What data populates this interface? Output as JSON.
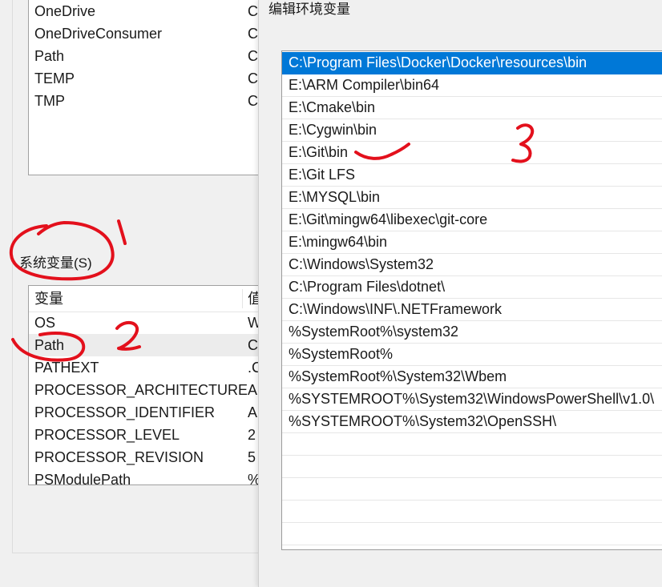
{
  "env_window": {
    "user_vars": [
      {
        "name": "OneDrive",
        "value": "C"
      },
      {
        "name": "OneDriveConsumer",
        "value": "C"
      },
      {
        "name": "Path",
        "value": "C"
      },
      {
        "name": "TEMP",
        "value": "C"
      },
      {
        "name": "TMP",
        "value": "C"
      }
    ],
    "system_section_label": "系统变量(S)",
    "system_table": {
      "header_variable": "变量",
      "header_value": "值",
      "rows": [
        {
          "name": "OS",
          "value": "W"
        },
        {
          "name": "Path",
          "value": "C"
        },
        {
          "name": "PATHEXT",
          "value": ".C"
        },
        {
          "name": "PROCESSOR_ARCHITECTURE",
          "value": "A"
        },
        {
          "name": "PROCESSOR_IDENTIFIER",
          "value": "A"
        },
        {
          "name": "PROCESSOR_LEVEL",
          "value": "2"
        },
        {
          "name": "PROCESSOR_REVISION",
          "value": "5"
        },
        {
          "name": "PSModulePath",
          "value": "%"
        }
      ],
      "selected_index": 1
    }
  },
  "edit_dialog": {
    "title": "编辑环境变量",
    "paths": [
      "C:\\Program Files\\Docker\\Docker\\resources\\bin",
      "E:\\ARM Compiler\\bin64",
      "E:\\Cmake\\bin",
      "E:\\Cygwin\\bin",
      "E:\\Git\\bin",
      "E:\\Git LFS",
      "E:\\MYSQL\\bin",
      "E:\\Git\\mingw64\\libexec\\git-core",
      "E:\\mingw64\\bin",
      "C:\\Windows\\System32",
      "C:\\Program Files\\dotnet\\",
      "C:\\Windows\\INF\\.NETFramework",
      "%SystemRoot%\\system32",
      "%SystemRoot%",
      "%SystemRoot%\\System32\\Wbem",
      "%SYSTEMROOT%\\System32\\WindowsPowerShell\\v1.0\\",
      "%SYSTEMROOT%\\System32\\OpenSSH\\"
    ],
    "selected_index": 0
  },
  "annotations": {
    "step1": "1",
    "step2": "2",
    "step3": "3",
    "color": "#e3101c"
  },
  "colors": {
    "selection_blue": "#0078d7",
    "selection_gray": "#ececec"
  }
}
